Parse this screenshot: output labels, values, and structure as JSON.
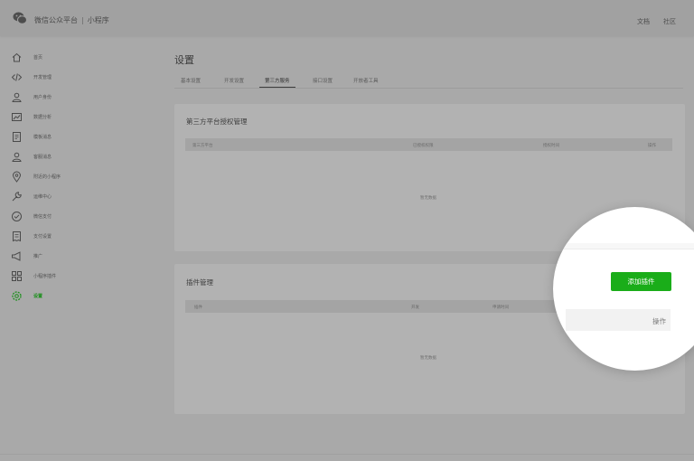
{
  "header": {
    "brand": "微信公众平台",
    "separator": "|",
    "product": "小程序",
    "links": [
      "文档",
      "社区"
    ]
  },
  "sidebar": {
    "items": [
      {
        "label": "首页",
        "icon": "home-icon"
      },
      {
        "label": "开发管理",
        "icon": "code-icon"
      },
      {
        "label": "用户身份",
        "icon": "user-icon"
      },
      {
        "label": "数据分析",
        "icon": "chart-icon"
      },
      {
        "label": "模板消息",
        "icon": "document-icon"
      },
      {
        "label": "客服消息",
        "icon": "customer-service-icon"
      },
      {
        "label": "附近的小程序",
        "icon": "location-icon"
      },
      {
        "label": "运维中心",
        "icon": "wrench-icon"
      },
      {
        "label": "微信支付",
        "icon": "payment-icon"
      },
      {
        "label": "支付设置",
        "icon": "bill-icon"
      },
      {
        "label": "推广",
        "icon": "megaphone-icon"
      },
      {
        "label": "小程序插件",
        "icon": "grid-icon"
      },
      {
        "label": "设置",
        "icon": "gear-icon",
        "active": true
      }
    ]
  },
  "main": {
    "title": "设置",
    "tabs": [
      {
        "label": "基本设置"
      },
      {
        "label": "开发设置"
      },
      {
        "label": "第三方服务",
        "active": true
      },
      {
        "label": "接口设置"
      },
      {
        "label": "开放者工具"
      }
    ],
    "third_party": {
      "title": "第三方平台授权管理",
      "columns": [
        "第三方平台",
        "已授权权限",
        "授权时间",
        "操作"
      ],
      "empty_text": "暂无数据"
    },
    "plugins": {
      "title": "插件管理",
      "columns": [
        "插件",
        "开发",
        "申请时间",
        "操作"
      ],
      "empty_text": "暂无数据",
      "add_button": "添加插件",
      "operation_label": "操作"
    }
  },
  "colors": {
    "accent_green": "#1aad19",
    "active_nav": "#1b8f1b"
  }
}
